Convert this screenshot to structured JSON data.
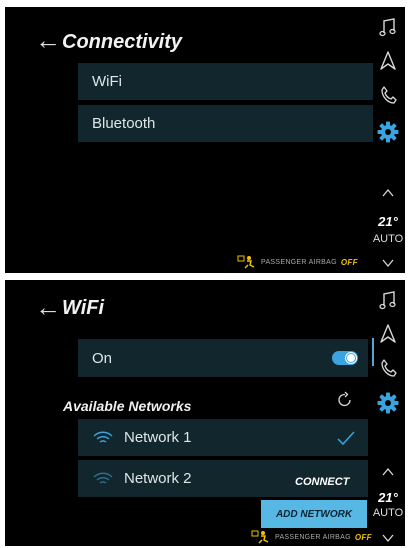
{
  "screen1": {
    "title": "Connectivity",
    "items": [
      {
        "label": "WiFi"
      },
      {
        "label": "Bluetooth"
      }
    ],
    "sidebar": {
      "temp": "21°",
      "auto": "AUTO"
    },
    "airbag": {
      "label": "PASSENGER AIRBAG",
      "state": "OFF"
    }
  },
  "screen2": {
    "title": "WiFi",
    "wifi_toggle": {
      "label": "On",
      "state": "on"
    },
    "section": "Available Networks",
    "networks": [
      {
        "name": "Network 1",
        "connected": true
      },
      {
        "name": "Network 2",
        "connected": false
      }
    ],
    "connect_label": "CONNECT",
    "add_network_label": "ADD NETWORK",
    "sidebar": {
      "temp": "21°",
      "auto": "AUTO"
    },
    "airbag": {
      "label": "PASSENGER AIRBAG",
      "state": "OFF"
    }
  },
  "colors": {
    "accent": "#3aa4e0",
    "button": "#57b8e6",
    "airbag_off": "#f2c200",
    "list_bg": "#12262d"
  },
  "icons": [
    "back-arrow-icon",
    "music-icon",
    "navigation-icon",
    "phone-icon",
    "settings-gear-icon",
    "chevron-up-icon",
    "chevron-down-icon",
    "wifi-icon",
    "refresh-icon",
    "checkmark-icon",
    "airbag-icon"
  ]
}
